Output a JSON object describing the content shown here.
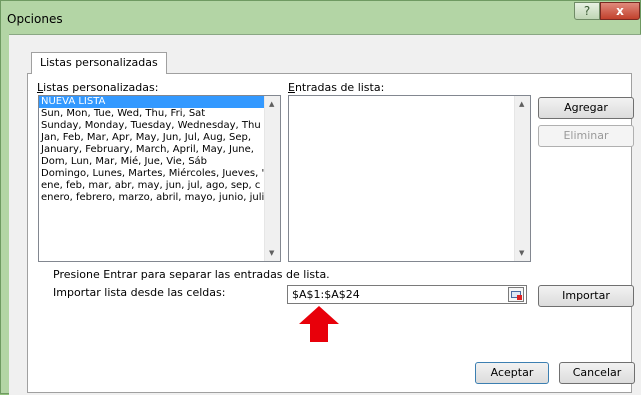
{
  "window": {
    "title": "Opciones",
    "help_label": "?",
    "close_label": "x"
  },
  "tab": {
    "label": "Listas personalizadas"
  },
  "custom_lists": {
    "label": "Listas personalizadas:",
    "items": [
      "NUEVA LISTA",
      "Sun, Mon, Tue, Wed, Thu, Fri, Sat",
      "Sunday, Monday, Tuesday, Wednesday, Thu",
      "Jan, Feb, Mar, Apr, May, Jun, Jul, Aug, Sep,",
      "January, February, March, April, May, June,",
      "Dom, Lun, Mar, Mié, Jue, Vie, Sáb",
      "Domingo, Lunes, Martes, Miércoles, Jueves, '",
      "ene, feb, mar, abr, may, jun, jul, ago, sep, c",
      "enero, febrero, marzo, abril, mayo, junio, juli"
    ],
    "selected_index": 0
  },
  "list_entries": {
    "label": "Entradas de lista:",
    "value": ""
  },
  "buttons": {
    "add": "Agregar",
    "delete": "Eliminar",
    "import": "Importar",
    "ok": "Aceptar",
    "cancel": "Cancelar"
  },
  "hint_text": "Presione Entrar para separar las entradas de lista.",
  "import_from": {
    "label": "Importar lista desde las celdas:",
    "value": "$A$1:$A$24"
  },
  "colors": {
    "selection": "#3399ff",
    "annotation_arrow": "#e8000a",
    "title_bar": "#b3d5a5"
  }
}
